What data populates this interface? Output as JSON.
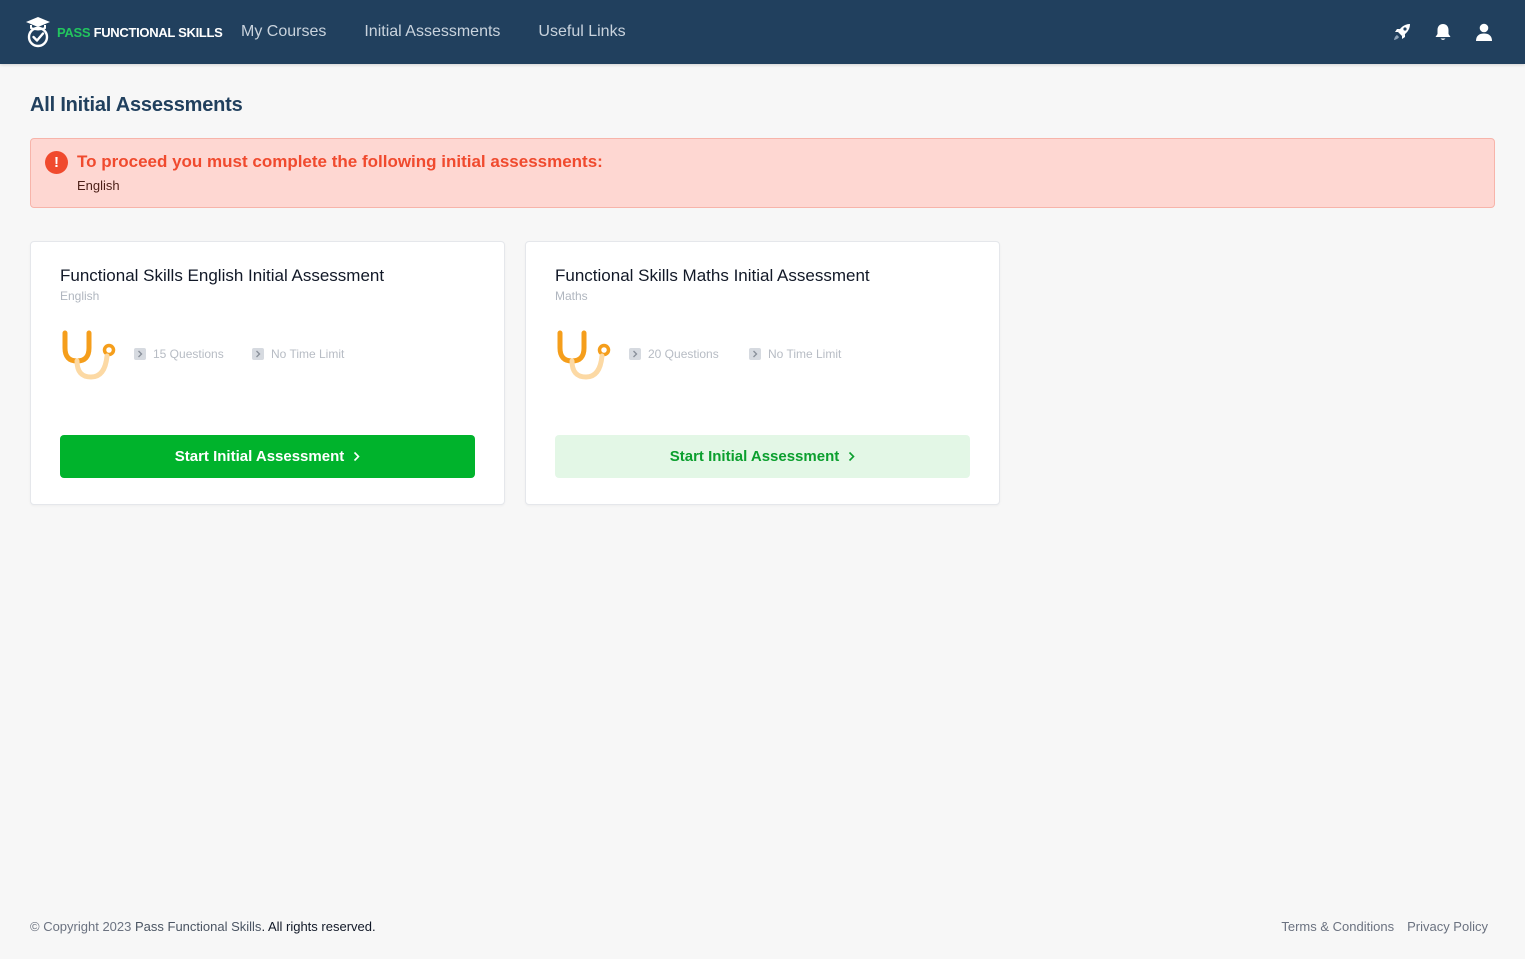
{
  "header": {
    "logo": {
      "pass": "PASS",
      "rest": "FUNCTIONAL SKILLS"
    },
    "nav": [
      {
        "label": "My Courses"
      },
      {
        "label": "Initial Assessments"
      },
      {
        "label": "Useful Links"
      }
    ],
    "icons": [
      "rocket-icon",
      "bell-icon",
      "user-icon"
    ]
  },
  "page": {
    "title": "All Initial Assessments"
  },
  "alert": {
    "icon": "exclamation-icon",
    "title": "To proceed you must complete the following initial assessments:",
    "detail": "English"
  },
  "cards": [
    {
      "title": "Functional Skills English Initial Assessment",
      "subject": "English",
      "questions": "15 Questions",
      "time_limit": "No Time Limit",
      "button": "Start Initial Assessment",
      "button_style": "primary"
    },
    {
      "title": "Functional Skills Maths Initial Assessment",
      "subject": "Maths",
      "questions": "20 Questions",
      "time_limit": "No Time Limit",
      "button": "Start Initial Assessment",
      "button_style": "secondary"
    }
  ],
  "footer": {
    "copyright_prefix": "© Copyright 2023 ",
    "brand": "Pass Functional Skills",
    "rights": ". All rights reserved.",
    "links": [
      {
        "label": "Terms & Conditions"
      },
      {
        "label": "Privacy Policy"
      }
    ]
  },
  "colors": {
    "header_bg": "#21405e",
    "accent_green": "#00b32c",
    "alert_red": "#f04a2e",
    "alert_bg": "#fed7d2",
    "logo_orange": "#f59e1b"
  }
}
